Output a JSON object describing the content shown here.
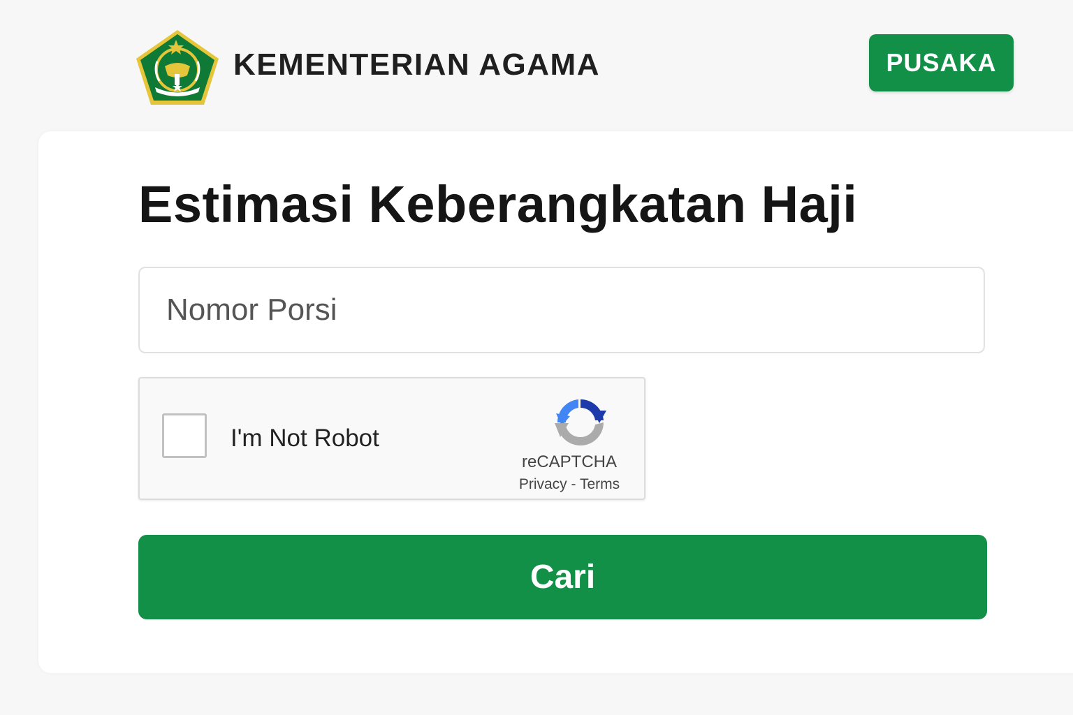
{
  "header": {
    "brand": "KEMENTERIAN AGAMA",
    "logo_icon": "kemenag-emblem-icon",
    "pusaka_label": "PUSAKA"
  },
  "main": {
    "title": "Estimasi Keberangkatan Haji",
    "porsi_input": {
      "value": "",
      "placeholder": "Nomor Porsi"
    },
    "recaptcha": {
      "checked": false,
      "label": "I'm Not Robot",
      "brand": "reCAPTCHA",
      "privacy": "Privacy",
      "separator": " - ",
      "terms": "Terms"
    },
    "submit_label": "Cari"
  },
  "colors": {
    "accent": "#139048",
    "background": "#f7f7f7",
    "card": "#ffffff",
    "logo_green": "#0f7a35",
    "logo_gold": "#e5c53a"
  }
}
